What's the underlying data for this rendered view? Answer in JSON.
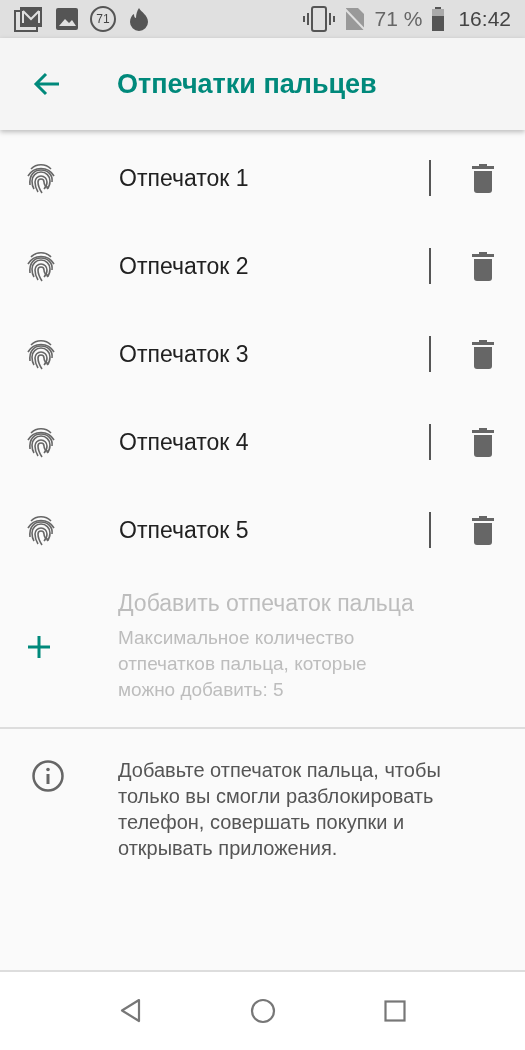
{
  "status_bar": {
    "notification_badge": "71",
    "battery": "71 %",
    "time": "16:42"
  },
  "app_bar": {
    "title": "Отпечатки пальцев"
  },
  "fingerprints": [
    {
      "name": "Отпечаток 1"
    },
    {
      "name": "Отпечаток 2"
    },
    {
      "name": "Отпечаток 3"
    },
    {
      "name": "Отпечаток 4"
    },
    {
      "name": "Отпечаток 5"
    }
  ],
  "add_item": {
    "title": "Добавить отпечаток пальца",
    "subtitle": "Максимальное количество отпечатков пальца, которые можно добавить: 5",
    "disabled": true
  },
  "info": {
    "text": "Добавьте отпечаток пальца, чтобы только вы смогли разблокировать телефон, совершать покупки и открывать приложения."
  }
}
